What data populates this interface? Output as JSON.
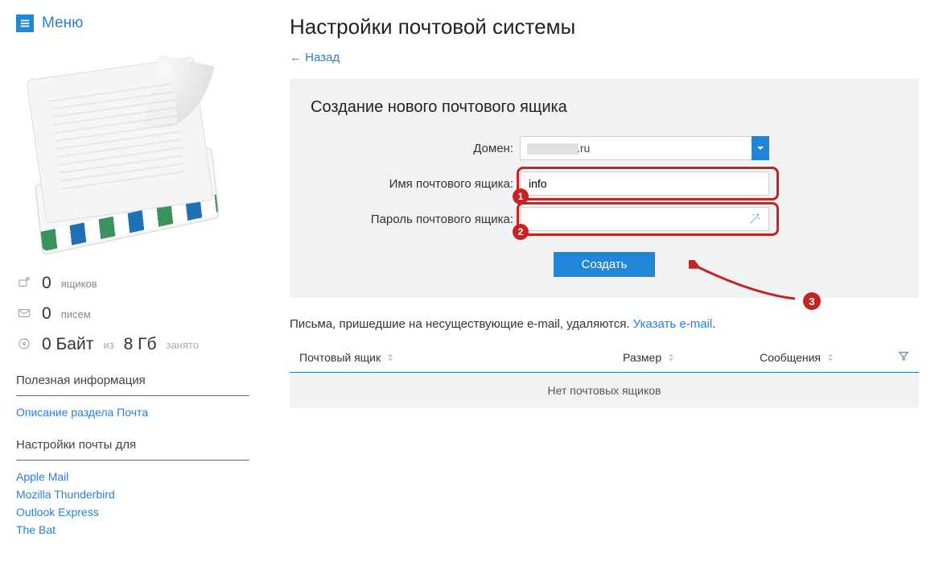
{
  "menu": {
    "label": "Меню"
  },
  "sidebar": {
    "stats": {
      "mailboxes_count": "0",
      "mailboxes_label": "ящиков",
      "letters_count": "0",
      "letters_label": "писем",
      "storage_used": "0 Байт",
      "storage_of": "из",
      "storage_total": "8 Гб",
      "storage_suffix": "занято"
    },
    "section_info": "Полезная информация",
    "link_help": "Описание раздела Почта",
    "section_clients": "Настройки почты для",
    "clients": [
      {
        "label": "Apple Mail"
      },
      {
        "label": "Mozilla Thunderbird"
      },
      {
        "label": "Outlook Express"
      },
      {
        "label": "The Bat"
      }
    ]
  },
  "page": {
    "title": "Настройки почтовой системы",
    "back": "← Назад"
  },
  "form": {
    "heading": "Создание нового почтового ящика",
    "domain_label": "Домен:",
    "domain_value_suffix": ".ru",
    "mailbox_label": "Имя почтового ящика:",
    "mailbox_value": "info",
    "password_label": "Пароль почтового ящика:",
    "password_value": "",
    "submit": "Создать"
  },
  "hint": {
    "text": "Письма, пришедшие на несуществующие e-mail, удаляются. ",
    "link": "Указать e-mail"
  },
  "table": {
    "col_mailbox": "Почтовый ящик",
    "col_size": "Размер",
    "col_messages": "Сообщения",
    "empty": "Нет почтовых ящиков"
  },
  "annot": {
    "step1": "1",
    "step2": "2",
    "step3": "3"
  }
}
